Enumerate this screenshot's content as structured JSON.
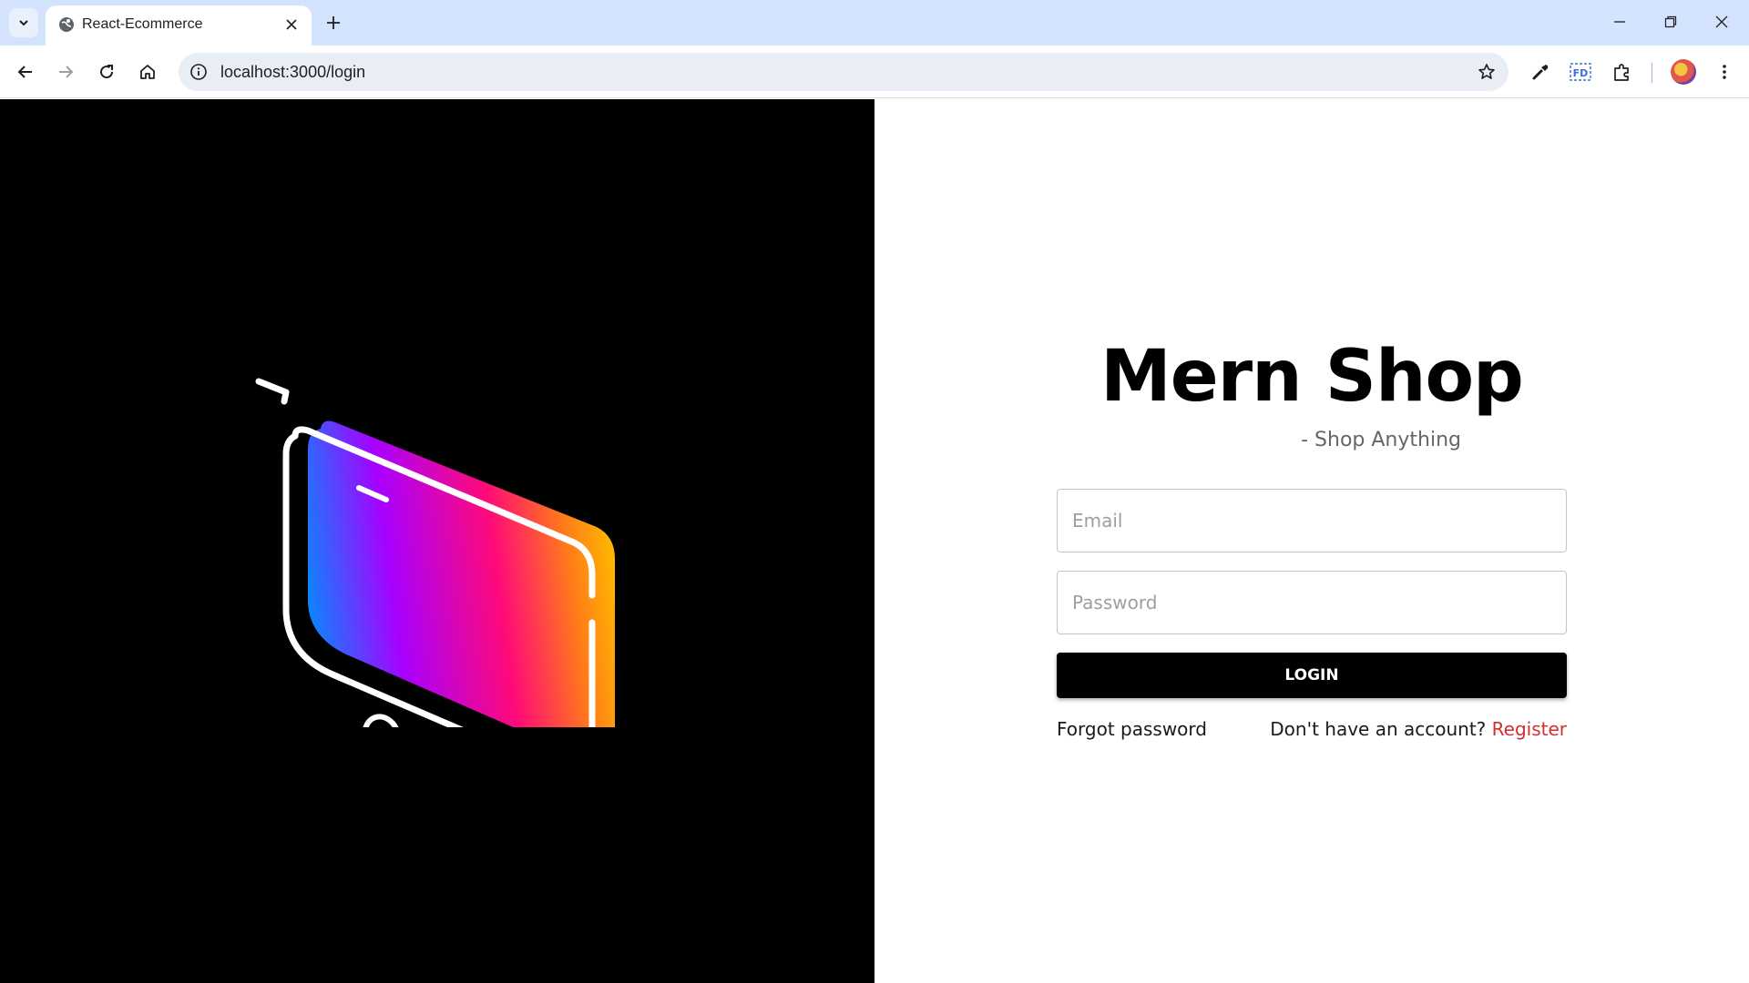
{
  "browser": {
    "tab_title": "React-Ecommerce",
    "url": "localhost:3000/login"
  },
  "page": {
    "brand": "Mern Shop",
    "tagline": "- Shop Anything",
    "email_placeholder": "Email",
    "password_placeholder": "Password",
    "login_label": "LOGIN",
    "forgot_label": "Forgot password",
    "account_prompt": "Don't have an account?",
    "register_label": "Register"
  },
  "icons": {
    "tab_search": "chevron-down-icon",
    "favicon": "globe-icon",
    "back": "arrow-left-icon",
    "forward": "arrow-right-icon",
    "reload": "reload-icon",
    "home": "home-icon",
    "site_info": "info-icon",
    "bookmark": "star-icon",
    "eyedropper": "eyedropper-icon",
    "font_ext": "font-extension-icon",
    "extensions": "puzzle-icon",
    "menu": "more-vertical-icon",
    "illustration": "shopping-cart-icon"
  },
  "colors": {
    "tabstrip": "#d3e3fd",
    "left_panel": "#000000",
    "register_link": "#d32f2f",
    "login_button": "#000000"
  }
}
